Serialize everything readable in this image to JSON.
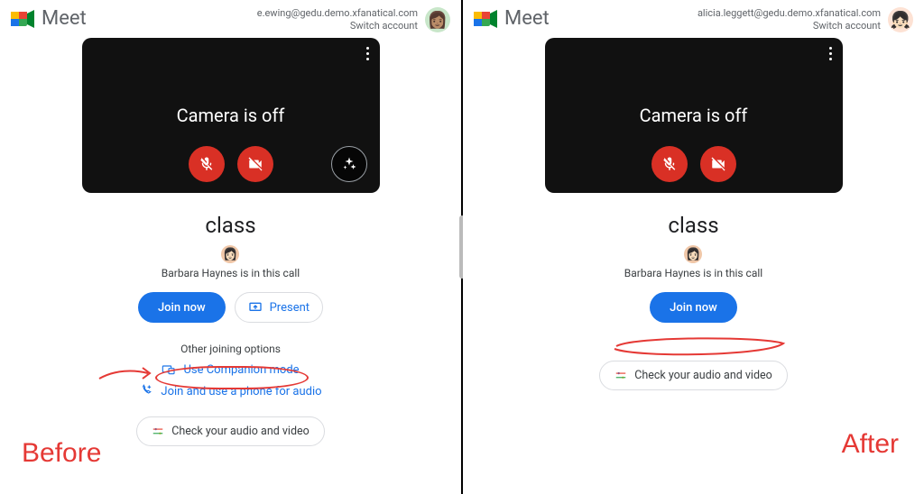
{
  "before": {
    "appName": "Meet",
    "account": {
      "email": "e.ewing@gedu.demo.xfanatical.com",
      "switch": "Switch account",
      "avatarEmoji": "👩🏽"
    },
    "camera_status": "Camera is off",
    "meeting_name": "class",
    "in_call_text": "Barbara Haynes is in this call",
    "in_call_avatar_emoji": "👩🏻",
    "join_label": "Join now",
    "present_label": "Present",
    "options_title": "Other joining options",
    "option_companion": "Use Companion mode",
    "option_phone": "Join and use a phone for audio",
    "check_av": "Check your audio and video",
    "annotation_label": "Before"
  },
  "after": {
    "appName": "Meet",
    "account": {
      "email": "alicia.leggett@gedu.demo.xfanatical.com",
      "switch": "Switch account",
      "avatarEmoji": "👧🏻"
    },
    "camera_status": "Camera is off",
    "meeting_name": "class",
    "in_call_text": "Barbara Haynes is in this call",
    "in_call_avatar_emoji": "👩🏻",
    "join_label": "Join now",
    "check_av": "Check your audio and video",
    "annotation_label": "After"
  }
}
